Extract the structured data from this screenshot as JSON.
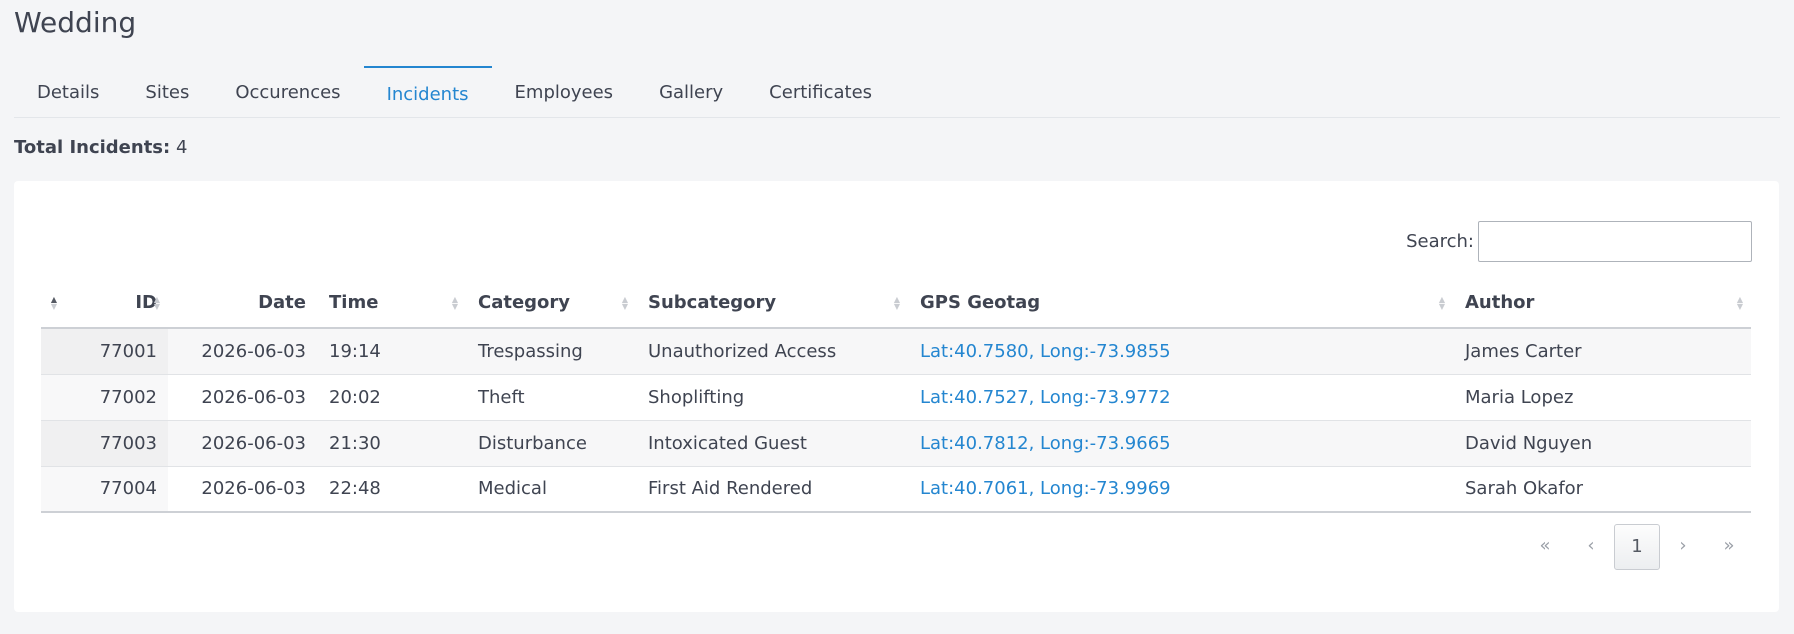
{
  "page": {
    "title": "Wedding"
  },
  "tabs": [
    {
      "label": "Details"
    },
    {
      "label": "Sites"
    },
    {
      "label": "Occurences"
    },
    {
      "label": "Incidents"
    },
    {
      "label": "Employees"
    },
    {
      "label": "Gallery"
    },
    {
      "label": "Certificates"
    }
  ],
  "active_tab": "Incidents",
  "summary": {
    "label": "Total Incidents:",
    "value": "4"
  },
  "search": {
    "label": "Search:",
    "value": ""
  },
  "table": {
    "columns": [
      "",
      "ID",
      "Date",
      "Time",
      "Category",
      "Subcategory",
      "GPS Geotag",
      "Author"
    ],
    "rows": [
      {
        "id": "77001",
        "date": "2026-06-03",
        "time": "19:14",
        "category": "Trespassing",
        "subcategory": "Unauthorized Access",
        "gps": "Lat:40.7580, Long:-73.9855",
        "author": "James Carter"
      },
      {
        "id": "77002",
        "date": "2026-06-03",
        "time": "20:02",
        "category": "Theft",
        "subcategory": "Shoplifting",
        "gps": "Lat:40.7527, Long:-73.9772",
        "author": "Maria Lopez"
      },
      {
        "id": "77003",
        "date": "2026-06-03",
        "time": "21:30",
        "category": "Disturbance",
        "subcategory": "Intoxicated Guest",
        "gps": "Lat:40.7812, Long:-73.9665",
        "author": "David Nguyen"
      },
      {
        "id": "77004",
        "date": "2026-06-03",
        "time": "22:48",
        "category": "Medical",
        "subcategory": "First Aid Rendered",
        "gps": "Lat:40.7061, Long:-73.9969",
        "author": "Sarah Okafor"
      }
    ]
  },
  "pagination": {
    "first": "«",
    "prev": "‹",
    "current": "1",
    "next": "›",
    "last": "»"
  },
  "colors": {
    "accent": "#2486d0",
    "text": "#3f4451",
    "background": "#f4f5f7"
  }
}
